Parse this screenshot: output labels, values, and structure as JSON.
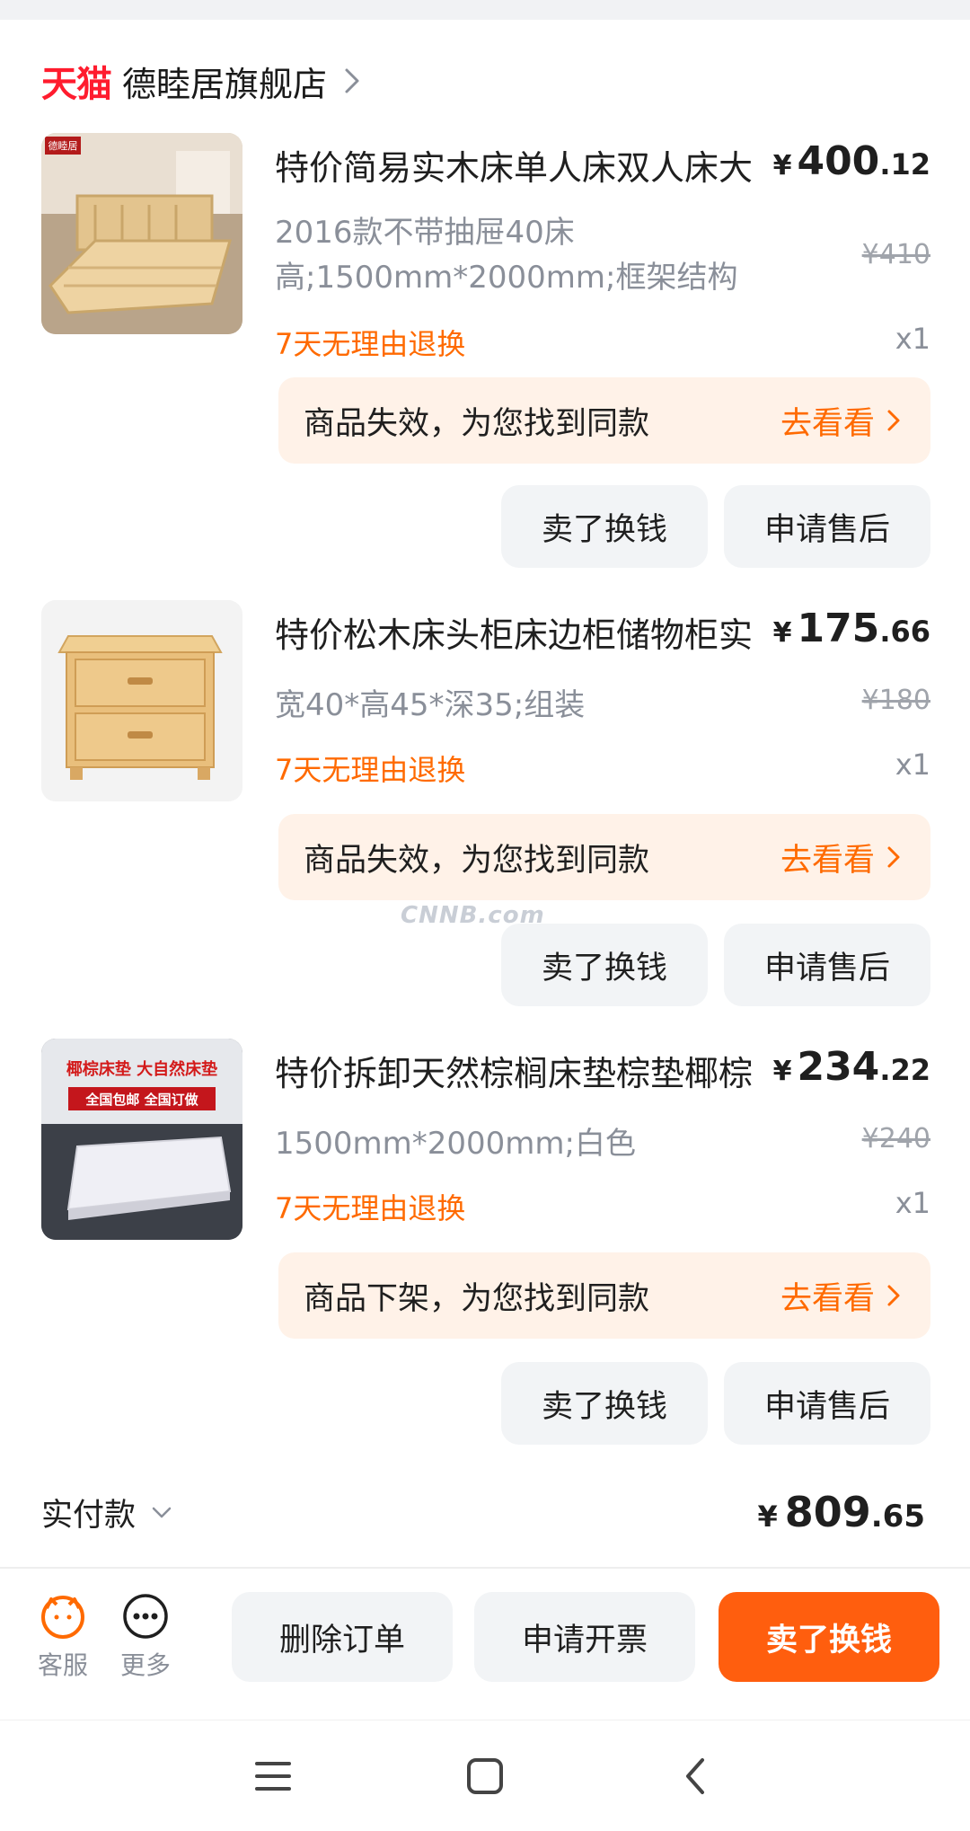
{
  "store": {
    "logo": "天猫",
    "name": "德睦居旗舰店"
  },
  "items": [
    {
      "title": "特价简易实木床单人床双人床大",
      "price_yen": "¥",
      "price_int": "400",
      "price_dec": ".12",
      "spec": "2016款不带抽屉40床高;1500mm*2000mm;框架结构",
      "original_price": "¥410",
      "return_policy": "7天无理由退换",
      "quantity": "x1",
      "notice": "商品失效，为您找到同款",
      "notice_link": "去看看",
      "btn_sell": "卖了换钱",
      "btn_after_sale": "申请售后",
      "thumb_badge": "德睦居"
    },
    {
      "title": "特价松木床头柜床边柜储物柜实",
      "price_yen": "¥",
      "price_int": "175",
      "price_dec": ".66",
      "spec": "宽40*高45*深35;组装",
      "original_price": "¥180",
      "return_policy": "7天无理由退换",
      "quantity": "x1",
      "notice": "商品失效，为您找到同款",
      "notice_link": "去看看",
      "btn_sell": "卖了换钱",
      "btn_after_sale": "申请售后"
    },
    {
      "title": "特价拆卸天然棕榈床垫棕垫椰棕",
      "price_yen": "¥",
      "price_int": "234",
      "price_dec": ".22",
      "spec": "1500mm*2000mm;白色",
      "original_price": "¥240",
      "return_policy": "7天无理由退换",
      "quantity": "x1",
      "notice": "商品下架，为您找到同款",
      "notice_link": "去看看",
      "btn_sell": "卖了换钱",
      "btn_after_sale": "申请售后",
      "thumb_text_1": "椰棕床垫 大自然床垫",
      "thumb_text_2": "全国包邮 全国订做"
    }
  ],
  "summary": {
    "label": "实付款",
    "yen": "¥",
    "int": "809",
    "dec": ".65"
  },
  "bottom_bar": {
    "service_label": "客服",
    "more_label": "更多",
    "delete_order": "删除订单",
    "request_invoice": "申请开票",
    "sell_for_cash": "卖了换钱"
  },
  "watermark": "CNNB.com",
  "colors": {
    "accent": "#ff5e0e",
    "tmall_red": "#ff1c2e",
    "notice_bg": "#fff2e8"
  }
}
